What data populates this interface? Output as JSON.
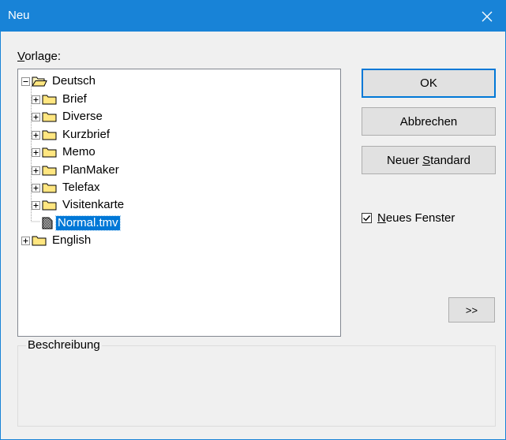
{
  "window": {
    "title": "Neu"
  },
  "label_vorlage": {
    "underline": "V",
    "rest": "orlage:"
  },
  "tree": {
    "root_deutsch": "Deutsch",
    "children": [
      "Brief",
      "Diverse",
      "Kurzbrief",
      "Memo",
      "PlanMaker",
      "Telefax",
      "Visitenkarte"
    ],
    "file": "Normal.tmv",
    "root_english": "English"
  },
  "buttons": {
    "ok": "OK",
    "cancel": "Abbrechen",
    "new_default_pre": "Neuer ",
    "new_default_u": "S",
    "new_default_post": "tandard",
    "more": ">>"
  },
  "checkbox": {
    "checked": true,
    "underline": "N",
    "rest": "eues Fenster"
  },
  "description": {
    "legend": "Beschreibung",
    "text": ""
  },
  "colors": {
    "titlebar": "#1883d7",
    "selection": "#0078d7",
    "default_button_border": "#0078d7"
  }
}
